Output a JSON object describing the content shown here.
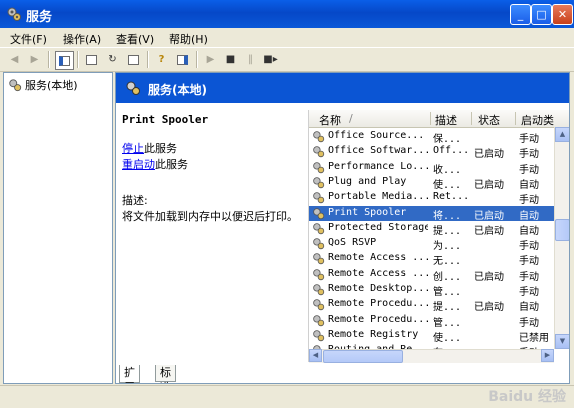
{
  "window": {
    "title": "服务",
    "minimize_label": "_",
    "maximize_label": "□",
    "close_label": "✕"
  },
  "menu": {
    "items": [
      "文件(F)",
      "操作(A)",
      "查看(V)",
      "帮助(H)"
    ]
  },
  "tree": {
    "root_label": "服务(本地)"
  },
  "panel_header": "服务(本地)",
  "selected_service": {
    "name": "Print Spooler",
    "stop_link": "停止",
    "stop_suffix": "此服务",
    "restart_link": "重启动",
    "restart_suffix": "此服务",
    "desc_label": "描述:",
    "desc_text": "将文件加载到内存中以便迟后打印。"
  },
  "columns": {
    "name": "名称",
    "sort_indicator": "/",
    "desc": "描述",
    "status": "状态",
    "startup": "启动类"
  },
  "rows": [
    {
      "name": "Office  Source...",
      "desc": "保...",
      "status": "",
      "startup": "手动"
    },
    {
      "name": "Office Softwar...",
      "desc": "Off...",
      "status": "已启动",
      "startup": "手动"
    },
    {
      "name": "Performance Lo...",
      "desc": "收...",
      "status": "",
      "startup": "手动"
    },
    {
      "name": "Plug and Play",
      "desc": "使...",
      "status": "已启动",
      "startup": "自动"
    },
    {
      "name": "Portable Media...",
      "desc": "Ret...",
      "status": "",
      "startup": "手动"
    },
    {
      "name": "Print Spooler",
      "desc": "将...",
      "status": "已启动",
      "startup": "自动"
    },
    {
      "name": "Protected Storage",
      "desc": "提...",
      "status": "已启动",
      "startup": "自动"
    },
    {
      "name": "QoS RSVP",
      "desc": "为...",
      "status": "",
      "startup": "手动"
    },
    {
      "name": "Remote Access ...",
      "desc": "无...",
      "status": "",
      "startup": "手动"
    },
    {
      "name": "Remote Access ...",
      "desc": "创...",
      "status": "已启动",
      "startup": "手动"
    },
    {
      "name": "Remote Desktop...",
      "desc": "管...",
      "status": "",
      "startup": "手动"
    },
    {
      "name": "Remote Procedu...",
      "desc": "提...",
      "status": "已启动",
      "startup": "自动"
    },
    {
      "name": "Remote Procedu...",
      "desc": "管...",
      "status": "",
      "startup": "手动"
    },
    {
      "name": "Remote Registry",
      "desc": "使...",
      "status": "",
      "startup": "已禁用"
    },
    {
      "name": "Routing and Re...",
      "desc": "在...",
      "status": "",
      "startup": "手动"
    }
  ],
  "tabs": [
    "扩展",
    "标准"
  ],
  "watermark": "Baidu 经验",
  "colors": {
    "selection": "#316ac5",
    "title_blue": "#0b55d4",
    "link": "#0000ee"
  }
}
